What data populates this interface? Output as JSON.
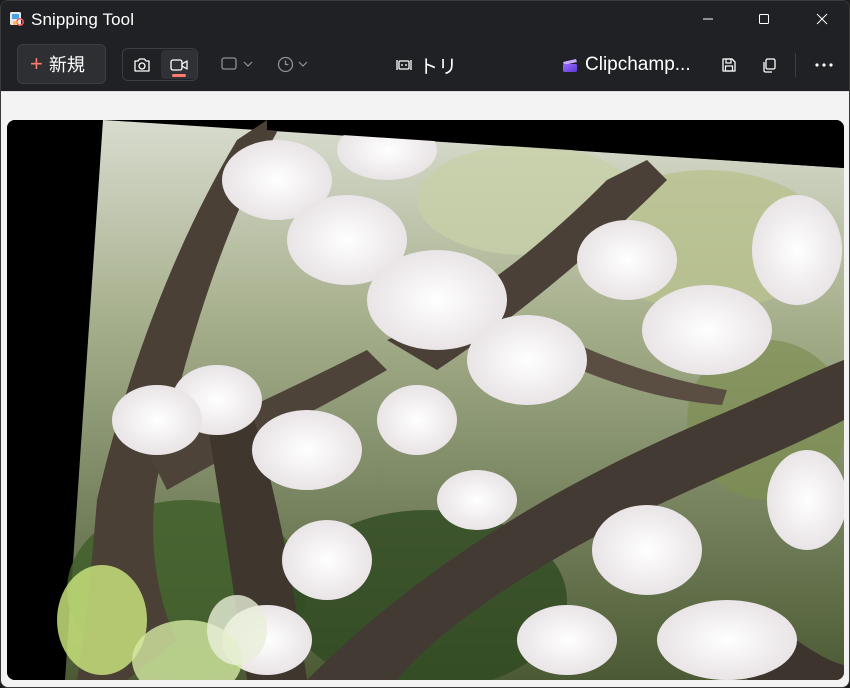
{
  "window": {
    "title": "Snipping Tool",
    "controls": {
      "minimize": "minimize-icon",
      "maximize": "maximize-icon",
      "close": "close-icon"
    }
  },
  "toolbar": {
    "new_label": "新規",
    "trim_label": "トリム",
    "clipchamp_label": "Clipchamp...",
    "modes": [
      {
        "name": "screenshot",
        "icon": "camera-icon",
        "selected": false
      },
      {
        "name": "record",
        "icon": "video-camera-icon",
        "selected": true
      }
    ],
    "accent_color": "#ff7b6b"
  },
  "preview": {
    "content": "video-recording-preview"
  }
}
